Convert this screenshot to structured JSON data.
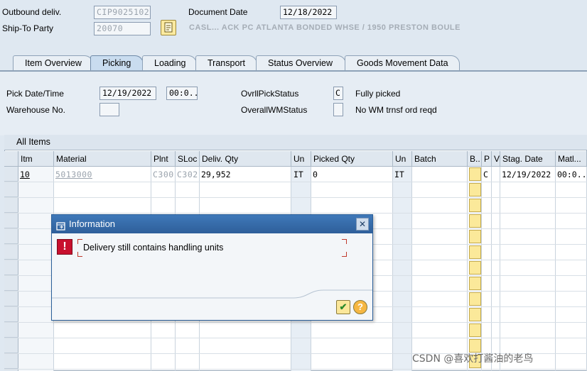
{
  "header": {
    "outbound_label": "Outbound deliv.",
    "outbound_value": "CIP9025102",
    "shipto_label": "Ship-To Party",
    "shipto_value": "20070",
    "document_date_label": "Document Date",
    "document_date_value": "12/18/2022",
    "shipto_name": "CASL... ACK PC ATLANTA BONDED WHSE / 1950 PRESTON BOULE"
  },
  "tabs": [
    {
      "label": "Item Overview",
      "active": false
    },
    {
      "label": "Picking",
      "active": true
    },
    {
      "label": "Loading",
      "active": false
    },
    {
      "label": "Transport",
      "active": false
    },
    {
      "label": "Status Overview",
      "active": false
    },
    {
      "label": "Goods Movement Data",
      "active": false
    }
  ],
  "picking": {
    "pick_date_label": "Pick Date/Time",
    "pick_date_value": "12/19/2022",
    "pick_time_value": "00:0...",
    "warehouse_label": "Warehouse No.",
    "warehouse_value": "",
    "ovrl_pick_status_label": "OvrllPickStatus",
    "ovrl_pick_status_value": "C",
    "ovrl_pick_status_text": "Fully picked",
    "overall_wm_label": "OverallWMStatus",
    "overall_wm_value": "",
    "overall_wm_text": "No WM trnsf ord reqd"
  },
  "grid": {
    "title": "All Items",
    "columns": [
      "Itm",
      "Material",
      "Plnt",
      "SLoc",
      "Deliv. Qty",
      "Un",
      "Picked Qty",
      "Un",
      "Batch",
      "B..",
      "P",
      "V",
      "Stag. Date",
      "Matl..."
    ],
    "rows": [
      {
        "itm": "10",
        "material": "5013000",
        "plnt": "C300",
        "sloc": "C302",
        "deliv_qty": "29,952",
        "un": "IT",
        "picked_qty": "0",
        "un2": "IT",
        "batch": "",
        "p": "C",
        "stag_date": "12/19/2022",
        "matl": "00:0..."
      }
    ]
  },
  "dialog": {
    "title": "Information",
    "message": "Delivery still contains handling units",
    "ok_icon": "check-icon",
    "help_icon": "help-icon"
  },
  "watermark": "CSDN @喜欢打酱油的老鸟"
}
